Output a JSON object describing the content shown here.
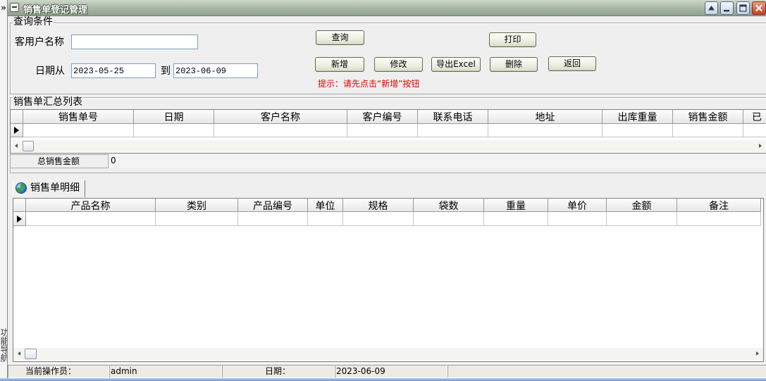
{
  "window": {
    "title": "销售单登记管理",
    "nav_arrow": "»",
    "nav_label": "功能导航"
  },
  "query": {
    "group_title": "查询条件",
    "customer_label": "客用户名称",
    "customer_value": "",
    "date_from_label": "日期从",
    "date_from": "2023-05-25",
    "date_to_label": "到",
    "date_to": "2023-06-09",
    "hint": "提示：请先点击“新增”按钮"
  },
  "buttons": {
    "search": "查询",
    "print": "打印",
    "add": "新增",
    "edit": "修改",
    "export": "导出Excel",
    "delete": "删除",
    "back": "返回"
  },
  "summary": {
    "title": "销售单汇总列表",
    "columns": [
      "销售单号",
      "日期",
      "客户名称",
      "客户编号",
      "联系电话",
      "地址",
      "出库重量",
      "销售金额",
      "已"
    ],
    "total_label": "总销售金额",
    "total_value": "0"
  },
  "detail": {
    "tab_label": "销售单明细",
    "columns": [
      "产品名称",
      "类别",
      "产品编号",
      "单位",
      "规格",
      "袋数",
      "重量",
      "单价",
      "金额",
      "备注"
    ]
  },
  "status_bar": {
    "operator_label": "当前操作员：",
    "operator": "admin",
    "date_label": "日期：",
    "date": "2023-06-09"
  },
  "icons": {
    "window_menu": "window-menu-icon",
    "roll_up": "arrow-up-icon",
    "minimize": "minimize-icon",
    "maximize": "maximize-icon",
    "close": "close-icon",
    "detail_tab": "globe-icon",
    "current_row": "row-pointer-icon",
    "scroll_left": "scroll-left-icon",
    "scroll_right": "scroll-right-icon"
  },
  "colors": {
    "hint_text": "#e00000",
    "close_button": "#c83e22",
    "title_bar": "#a6b4a4",
    "title_text": "#ffffff"
  }
}
